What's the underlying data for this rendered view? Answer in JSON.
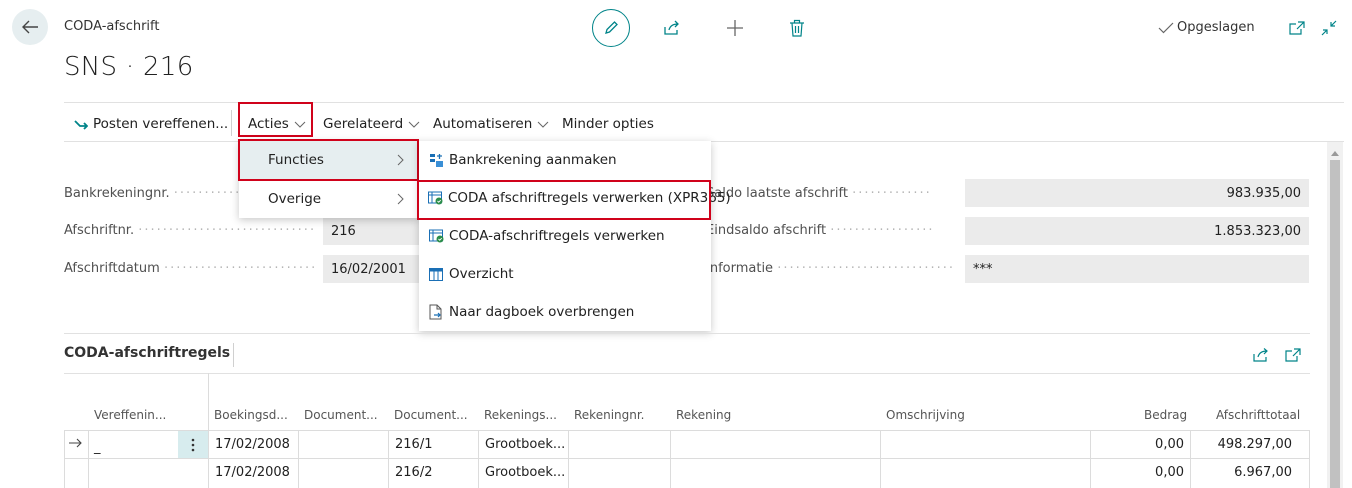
{
  "header": {
    "caption": "CODA-afschrift",
    "title": "SNS · 216",
    "saved_status": "Opgeslagen"
  },
  "actionbar": {
    "post_apply": "Posten vereffenen...",
    "acties": "Acties",
    "gerelateerd": "Gerelateerd",
    "automatiseren": "Automatiseren",
    "minder_opties": "Minder opties"
  },
  "acties_menu": {
    "items": [
      {
        "label": "Functies"
      },
      {
        "label": "Overige"
      }
    ]
  },
  "functies_menu": {
    "items": [
      {
        "label": "Bankrekening aanmaken",
        "icon": "bank-account-icon"
      },
      {
        "label": "CODA afschriftregels verwerken (XPR365)",
        "icon": "process-lines-icon"
      },
      {
        "label": "CODA-afschriftregels verwerken",
        "icon": "process-lines-icon"
      },
      {
        "label": "Overzicht",
        "icon": "table-icon"
      },
      {
        "label": "Naar dagboek overbrengen",
        "icon": "transfer-document-icon"
      }
    ]
  },
  "fields": {
    "left": [
      {
        "label": "Bankrekeningnr.",
        "value": ""
      },
      {
        "label": "Afschriftnr.",
        "value": "216"
      },
      {
        "label": "Afschriftdatum",
        "value": "16/02/2001"
      }
    ],
    "right": [
      {
        "label": "Saldo laatste afschrift",
        "value": "983.935,00"
      },
      {
        "label": "Eindsaldo afschrift",
        "value": "1.853.323,00"
      },
      {
        "label": "Informatie",
        "value": "***"
      }
    ]
  },
  "subpage": {
    "title": "CODA-afschriftregels",
    "columns": [
      "Vereffenin...",
      "Boekingsd...",
      "Document...",
      "Document...",
      "Rekenings...",
      "Rekeningnr.",
      "Rekening",
      "Omschrijving",
      "Bedrag",
      "Afschrifttotaal"
    ],
    "rows": [
      {
        "vereffening": "_",
        "boekingsdatum": "17/02/2008",
        "document1": "",
        "document2": "216/1",
        "rekeningsoort": "Grootboek...",
        "rekeningnr": "",
        "rekening": "",
        "omschrijving": "",
        "bedrag": "0,00",
        "afschrifttotaal": "498.297,00"
      },
      {
        "vereffening": "",
        "boekingsdatum": "17/02/2008",
        "document1": "",
        "document2": "216/2",
        "rekeningsoort": "Grootboek...",
        "rekeningnr": "",
        "rekening": "",
        "omschrijving": "",
        "bedrag": "0,00",
        "afschrifttotaal": "6.967,00"
      }
    ]
  },
  "colors": {
    "accent": "#008489",
    "highlight_border": "#d0021b",
    "field_bg": "#ebebeb",
    "selected_menu_bg": "#e6eef0"
  }
}
